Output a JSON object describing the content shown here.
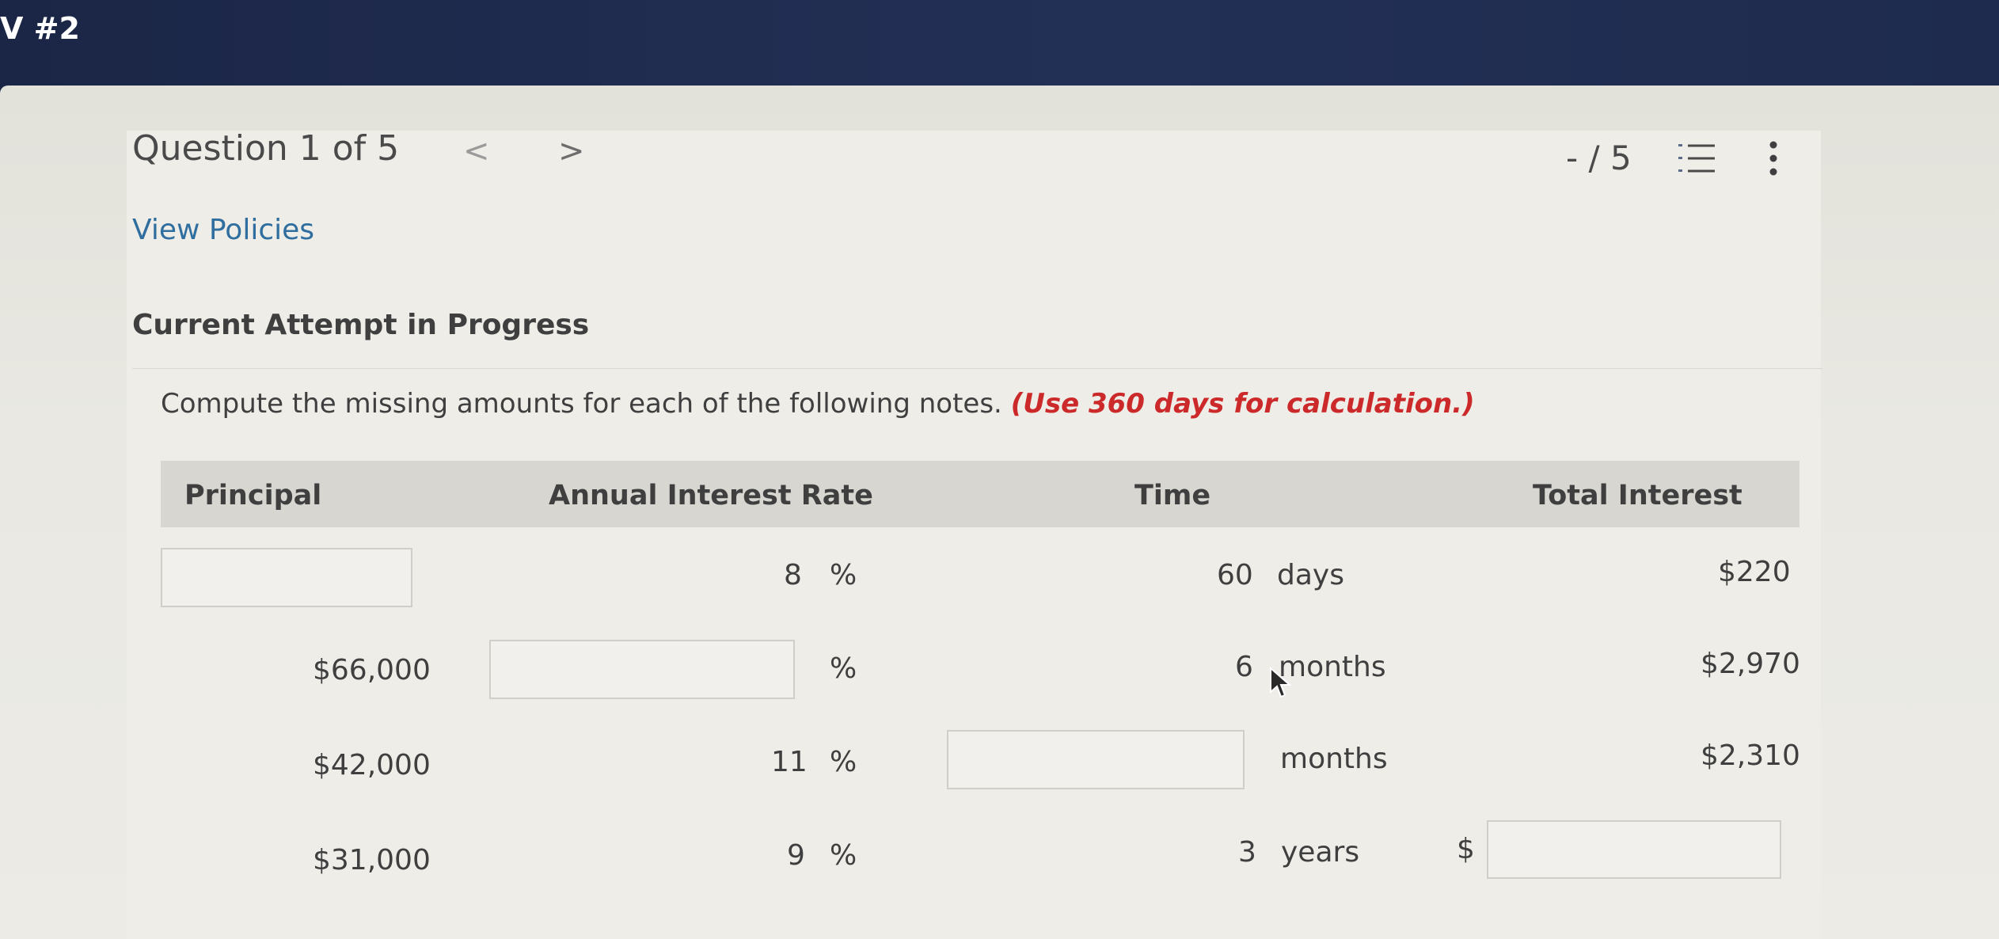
{
  "window": {
    "title": "V #2"
  },
  "header": {
    "question_label": "Question 1 of 5",
    "prev_glyph": "<",
    "next_glyph": ">",
    "score": "- / 5"
  },
  "links": {
    "view_policies": "View Policies"
  },
  "attempt": {
    "heading": "Current Attempt in Progress"
  },
  "instructions": {
    "text": "Compute the missing amounts for each of the following notes.",
    "note": "(Use 360 days for calculation.)"
  },
  "table": {
    "headers": {
      "principal": "Principal",
      "rate": "Annual Interest Rate",
      "time": "Time",
      "interest": "Total Interest"
    },
    "rows": [
      {
        "principal": "",
        "rate": "8",
        "rate_unit": "%",
        "time": "60",
        "time_unit": "days",
        "interest_prefix": "",
        "interest": "$220"
      },
      {
        "principal": "$66,000",
        "rate": "",
        "rate_unit": "%",
        "time": "6",
        "time_unit": "months",
        "interest_prefix": "",
        "interest": "$2,970"
      },
      {
        "principal": "$42,000",
        "rate": "11",
        "rate_unit": "%",
        "time": "",
        "time_unit": "months",
        "interest_prefix": "",
        "interest": "$2,310"
      },
      {
        "principal": "$31,000",
        "rate": "9",
        "rate_unit": "%",
        "time": "3",
        "time_unit": "years",
        "interest_prefix": "$",
        "interest": ""
      }
    ]
  },
  "colors": {
    "topbar": "#1e2a4c",
    "link": "#2f6e9e",
    "note_red": "#cc2a2a",
    "header_bg": "#d7d6d0"
  },
  "icons": {
    "prev": "chevron-left-icon",
    "next": "chevron-right-icon",
    "list": "numbered-list-icon",
    "more": "vertical-dots-icon",
    "cursor": "mouse-pointer-icon"
  }
}
